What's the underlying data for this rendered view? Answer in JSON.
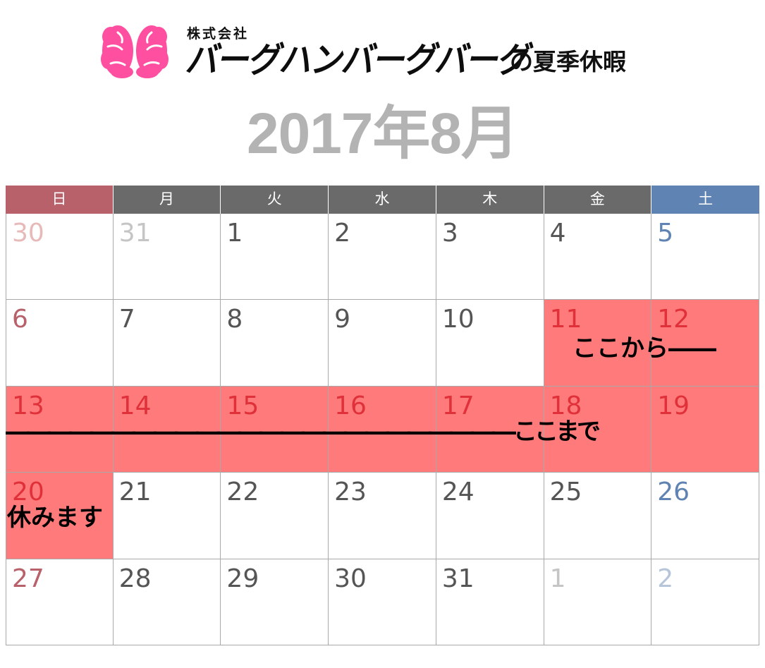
{
  "header": {
    "company_prefix": "株式会社",
    "company_name": "バーグハンバーグバーグ",
    "title_suffix": "の夏季休暇",
    "logo_icon": "brain-icon",
    "logo_color": "#ff4fa0"
  },
  "month_title": "2017年8月",
  "weekdays": [
    {
      "label": "日",
      "color": "#b8616b"
    },
    {
      "label": "月",
      "color": "#6a6a6a"
    },
    {
      "label": "火",
      "color": "#6a6a6a"
    },
    {
      "label": "水",
      "color": "#6a6a6a"
    },
    {
      "label": "木",
      "color": "#6a6a6a"
    },
    {
      "label": "金",
      "color": "#6a6a6a"
    },
    {
      "label": "土",
      "color": "#5f83b2"
    }
  ],
  "weeks": [
    [
      {
        "day": "30",
        "color": "#e7b9b9",
        "holiday": false
      },
      {
        "day": "31",
        "color": "#c5c5c5",
        "holiday": false
      },
      {
        "day": "1",
        "color": "#555555",
        "holiday": false
      },
      {
        "day": "2",
        "color": "#555555",
        "holiday": false
      },
      {
        "day": "3",
        "color": "#555555",
        "holiday": false
      },
      {
        "day": "4",
        "color": "#555555",
        "holiday": false
      },
      {
        "day": "5",
        "color": "#5f83b2",
        "holiday": false
      }
    ],
    [
      {
        "day": "6",
        "color": "#b8616b",
        "holiday": false
      },
      {
        "day": "7",
        "color": "#555555",
        "holiday": false
      },
      {
        "day": "8",
        "color": "#555555",
        "holiday": false
      },
      {
        "day": "9",
        "color": "#555555",
        "holiday": false
      },
      {
        "day": "10",
        "color": "#555555",
        "holiday": false
      },
      {
        "day": "11",
        "color": "#e0303a",
        "holiday": true
      },
      {
        "day": "12",
        "color": "#e0303a",
        "holiday": true
      }
    ],
    [
      {
        "day": "13",
        "color": "#e0303a",
        "holiday": true
      },
      {
        "day": "14",
        "color": "#e0303a",
        "holiday": true
      },
      {
        "day": "15",
        "color": "#e0303a",
        "holiday": true
      },
      {
        "day": "16",
        "color": "#e0303a",
        "holiday": true
      },
      {
        "day": "17",
        "color": "#e0303a",
        "holiday": true
      },
      {
        "day": "18",
        "color": "#e0303a",
        "holiday": true
      },
      {
        "day": "19",
        "color": "#e0303a",
        "holiday": true
      }
    ],
    [
      {
        "day": "20",
        "color": "#e0303a",
        "holiday": true
      },
      {
        "day": "21",
        "color": "#555555",
        "holiday": false
      },
      {
        "day": "22",
        "color": "#555555",
        "holiday": false
      },
      {
        "day": "23",
        "color": "#555555",
        "holiday": false
      },
      {
        "day": "24",
        "color": "#555555",
        "holiday": false
      },
      {
        "day": "25",
        "color": "#555555",
        "holiday": false
      },
      {
        "day": "26",
        "color": "#5f83b2",
        "holiday": false
      }
    ],
    [
      {
        "day": "27",
        "color": "#b8616b",
        "holiday": false
      },
      {
        "day": "28",
        "color": "#555555",
        "holiday": false
      },
      {
        "day": "29",
        "color": "#555555",
        "holiday": false
      },
      {
        "day": "30",
        "color": "#555555",
        "holiday": false
      },
      {
        "day": "31",
        "color": "#555555",
        "holiday": false
      },
      {
        "day": "1",
        "color": "#c5c5c5",
        "holiday": false
      },
      {
        "day": "2",
        "color": "#b6c5d9",
        "holiday": false
      }
    ]
  ],
  "annotations": {
    "start": "ここから――",
    "until": "――――――――――――――――――――――――ここまで",
    "rest": "休みます"
  },
  "holiday_color": "#ff7b7b"
}
